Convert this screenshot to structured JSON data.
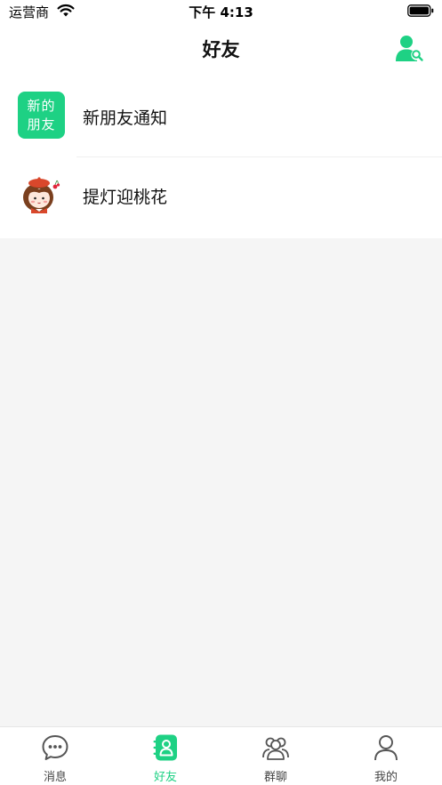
{
  "status_bar": {
    "carrier": "运营商",
    "time": "下午 4:13"
  },
  "header": {
    "title": "好友",
    "action_icon": "user-search-icon"
  },
  "colors": {
    "accent": "#1ed184",
    "background": "#f5f5f5"
  },
  "friends_list": [
    {
      "avatar_icon": "new-friend-badge",
      "avatar_text_line1": "新的",
      "avatar_text_line2": "朋友",
      "label": "新朋友通知"
    },
    {
      "avatar_icon": "girl-avatar",
      "label": "提灯迎桃花"
    }
  ],
  "tab_bar": {
    "active": "好友",
    "tabs": [
      {
        "label": "消息",
        "icon": "chat-bubble-icon"
      },
      {
        "label": "好友",
        "icon": "contacts-icon"
      },
      {
        "label": "群聊",
        "icon": "group-icon"
      },
      {
        "label": "我的",
        "icon": "person-icon"
      }
    ]
  }
}
